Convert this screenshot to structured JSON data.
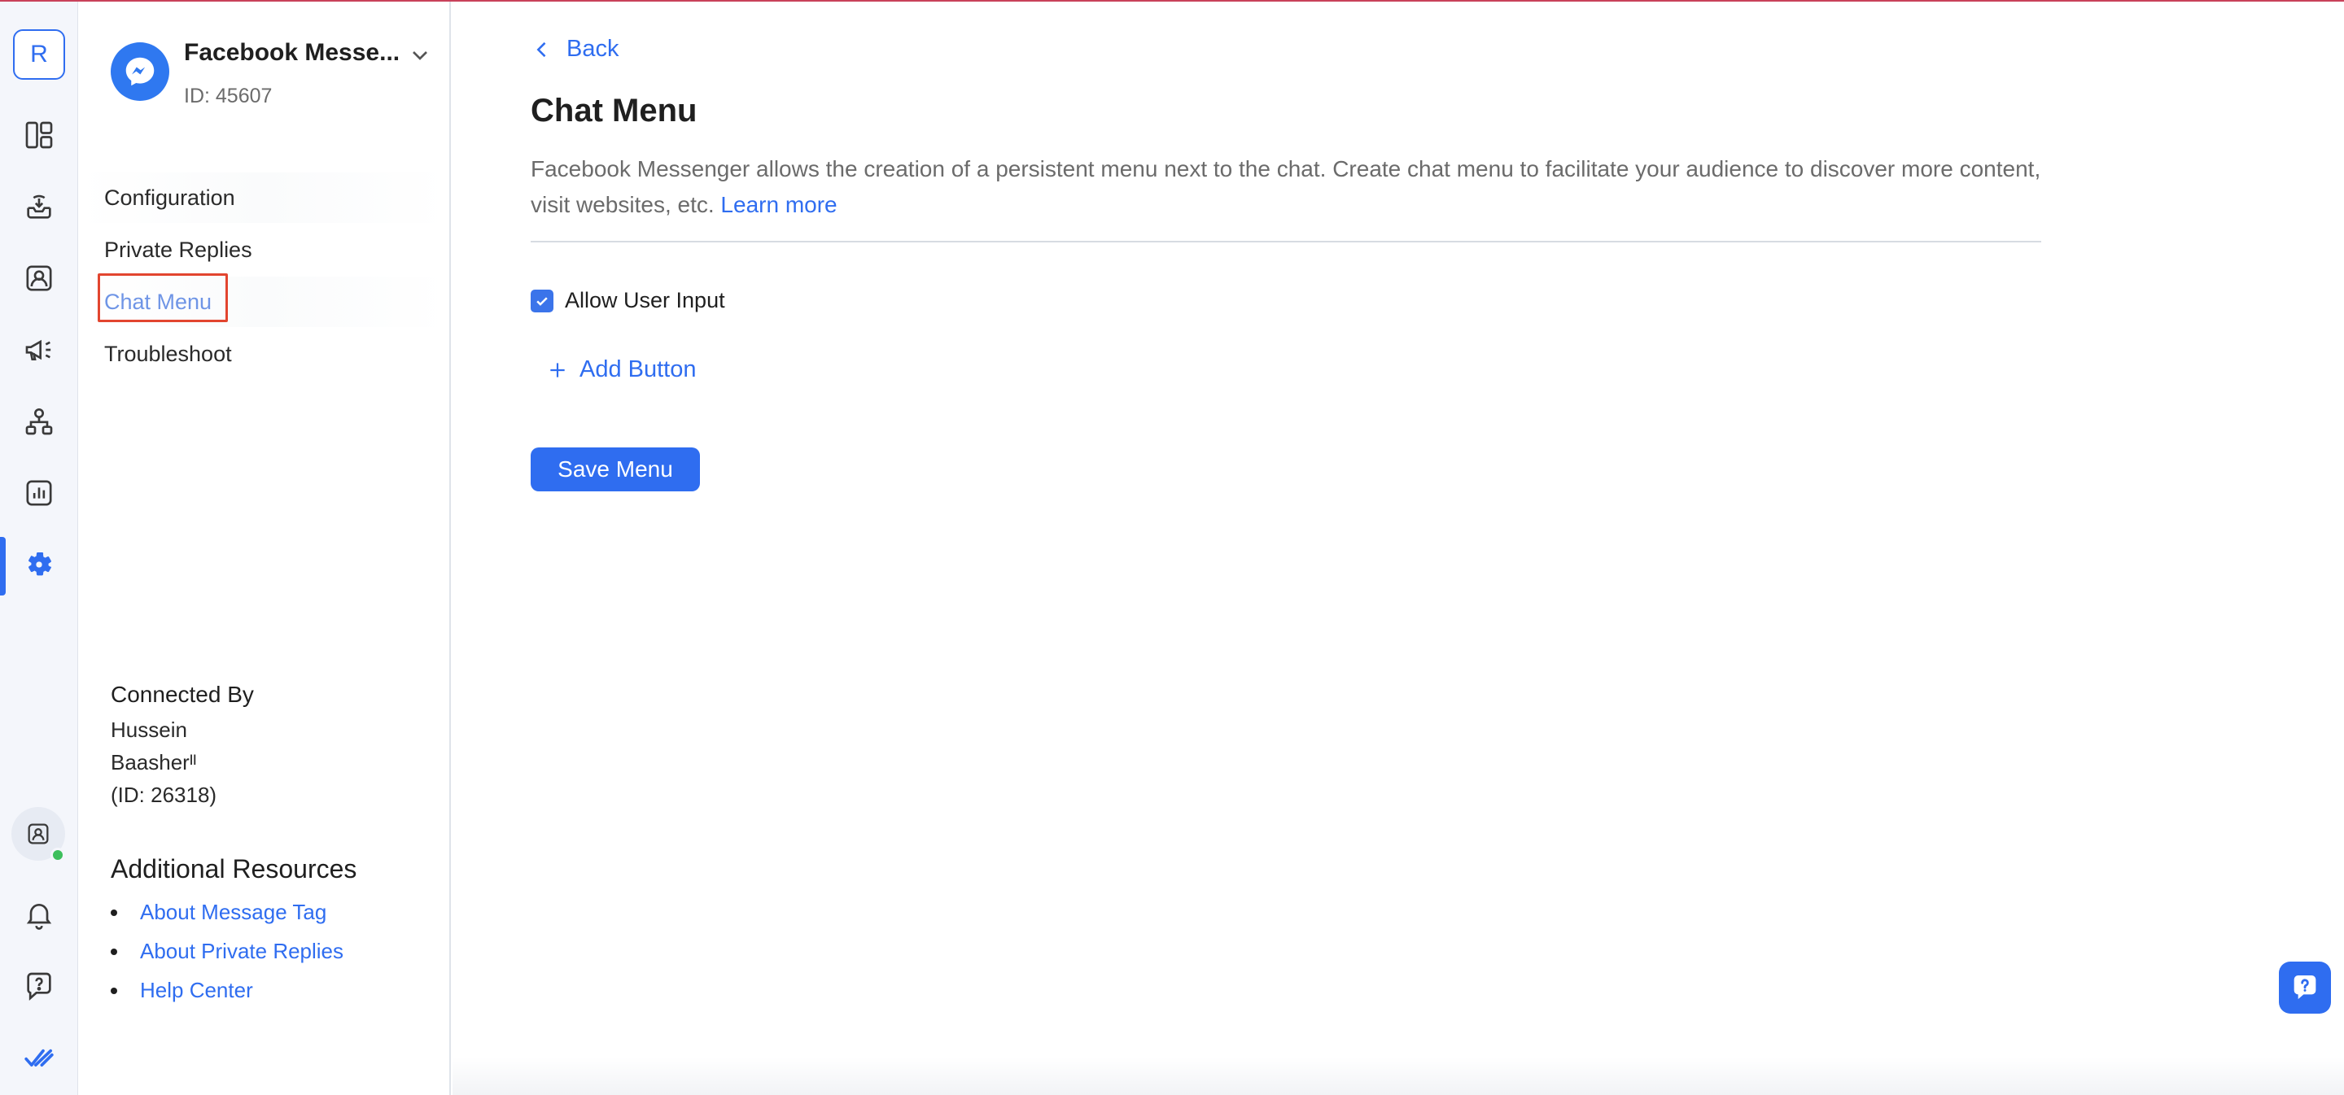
{
  "colors": {
    "accent": "#2f6df0",
    "highlight_frame": "#e2452f",
    "online": "#3dbf5c",
    "top_line": "#c9415a"
  },
  "rail": {
    "workspace_initial": "R",
    "icons": [
      "dashboard-icon",
      "inbox-icon",
      "contacts-icon",
      "broadcast-icon",
      "workflows-icon",
      "reports-icon",
      "settings-icon"
    ],
    "active": "settings-icon",
    "bottom_icons": [
      "agent-status-icon",
      "notifications-icon",
      "help-icon",
      "brand-logo-icon"
    ],
    "agent_status": "online"
  },
  "sidebar": {
    "channel": {
      "name": "Facebook Messe...",
      "id": "ID: 45607",
      "icon": "messenger-icon"
    },
    "nav": [
      {
        "label": "Configuration"
      },
      {
        "label": "Private Replies"
      },
      {
        "label": "Chat Menu",
        "active": true
      },
      {
        "label": "Troubleshoot"
      }
    ],
    "connected_by": {
      "title": "Connected By",
      "lines": [
        "Hussein",
        "Baasherᴵᴵ",
        "(ID: 26318)"
      ]
    },
    "resources": {
      "title": "Additional Resources",
      "links": [
        "About Message Tag",
        "About Private Replies",
        "Help Center"
      ]
    }
  },
  "main": {
    "back_label": "Back",
    "title": "Chat Menu",
    "description": "Facebook Messenger allows the creation of a persistent menu next to the chat. Create chat menu to facilitate your audience to discover more content, visit websites, etc.",
    "learn_more": "Learn more",
    "allow_user_input": {
      "label": "Allow User Input",
      "checked": true
    },
    "add_button_label": "Add Button",
    "save_label": "Save Menu"
  }
}
